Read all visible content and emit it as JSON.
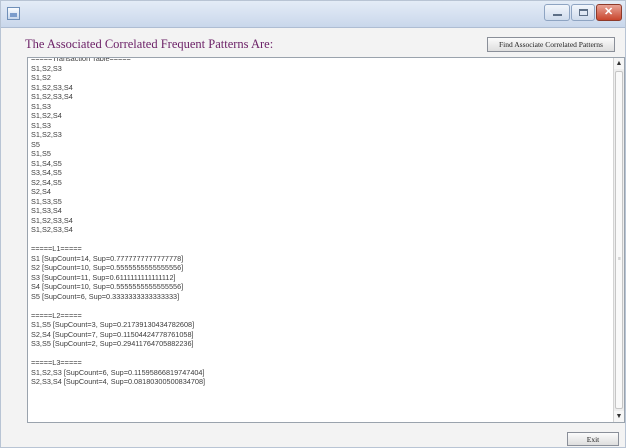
{
  "window": {
    "title": "",
    "icon": "java-app-icon",
    "controls": [
      "minimize-icon",
      "maximize-icon",
      "close-icon"
    ]
  },
  "main": {
    "heading": "The Associated Correlated Frequent Patterns Are:",
    "find_button_label": "Find Associate Correlated Patterns",
    "output_lines": [
      "=====Transaction Table=====",
      "S1,S2,S3",
      "S1,S2",
      "S1,S2,S3,S4",
      "S1,S2,S3,S4",
      "S1,S3",
      "S1,S2,S4",
      "S1,S3",
      "S1,S2,S3",
      "S5",
      "S1,S5",
      "S1,S4,S5",
      "S3,S4,S5",
      "S2,S4,S5",
      "S2,S4",
      "S1,S3,S5",
      "S1,S3,S4",
      "S1,S2,S3,S4",
      "S1,S2,S3,S4",
      "",
      "=====L1=====",
      "S1 [SupCount=14, Sup=0.7777777777777778]",
      "S2 [SupCount=10, Sup=0.5555555555555556]",
      "S3 [SupCount=11, Sup=0.6111111111111112]",
      "S4 [SupCount=10, Sup=0.5555555555555556]",
      "S5 [SupCount=6, Sup=0.3333333333333333]",
      "",
      "=====L2=====",
      "S1,S5 [SupCount=3, Sup=0.21739130434782608]",
      "S2,S4 [SupCount=7, Sup=0.11504424778761058]",
      "S3,S5 [SupCount=2, Sup=0.29411764705882236]",
      "",
      "=====L3=====",
      "S1,S2,S3 [SupCount=6, Sup=0.11595866819747404]",
      "S2,S3,S4 [SupCount=4, Sup=0.08180300500834708]"
    ]
  },
  "footer": {
    "exit_label": "Exit"
  },
  "scrollbar": {
    "up_glyph": "▲",
    "down_glyph": "▼",
    "grip_glyph": "≡"
  }
}
